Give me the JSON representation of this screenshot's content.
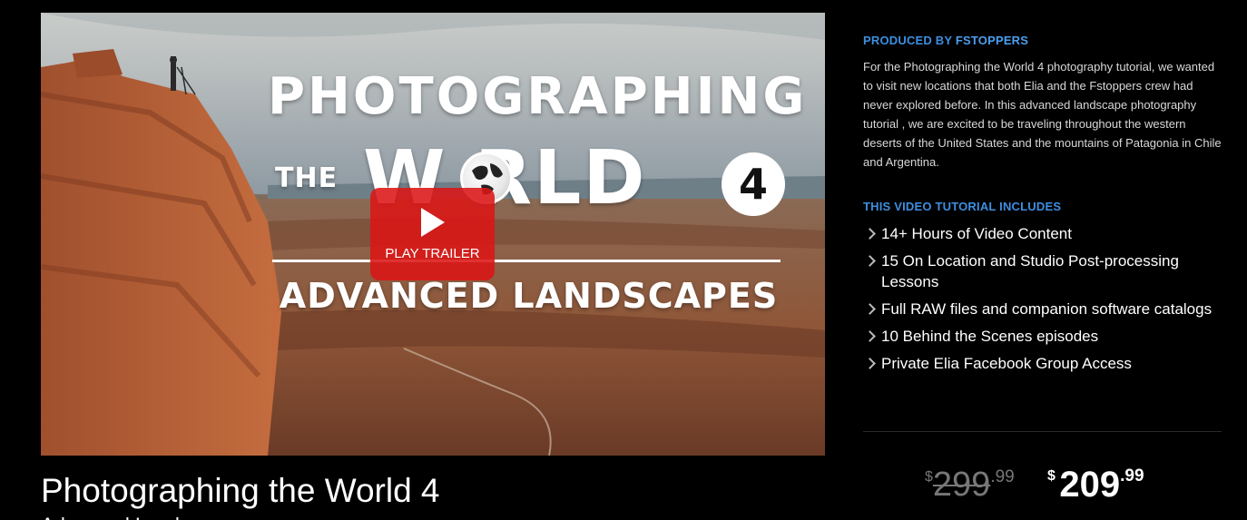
{
  "hero": {
    "title_line1": "PHOTOGRAPHING",
    "title_the": "THE",
    "title_world": "W  RLD",
    "title_number": "4",
    "title_subtitle": "ADVANCED LANDSCAPES",
    "play_label": "PLAY TRAILER",
    "play_icon": "play-icon",
    "globe_icon": "globe-icon"
  },
  "product": {
    "title": "Photographing the World 4",
    "subtitle": "Advanced Landscapes"
  },
  "sidebar": {
    "produced_prefix": "PRODUCED BY ",
    "produced_brand": "FSTOPPERS",
    "description": "For the Photographing the World 4 photography tutorial, we wanted to visit new locations that both Elia and the Fstoppers crew had never explored before. In this advanced landscape photography tutorial , we are excited to be traveling throughout the western deserts of the United States and the mountains of Patagonia in Chile and Argentina.",
    "includes_heading": "THIS VIDEO TUTORIAL INCLUDES",
    "includes": [
      "14+ Hours of Video Content",
      "15 On Location and Studio Post-processing Lessons",
      "Full RAW files and companion software catalogs",
      "10 Behind the Scenes episodes",
      "Private Elia Facebook Group Access"
    ],
    "chevron_icon": "chevron-right-icon"
  },
  "pricing": {
    "old_currency": "$",
    "old_main": "299",
    "old_cents": ".99",
    "new_currency": "$",
    "new_main": "209",
    "new_cents": ".99"
  },
  "colors": {
    "accent_blue": "#3d8fe0",
    "play_red": "#dc1616",
    "background": "#000000"
  }
}
